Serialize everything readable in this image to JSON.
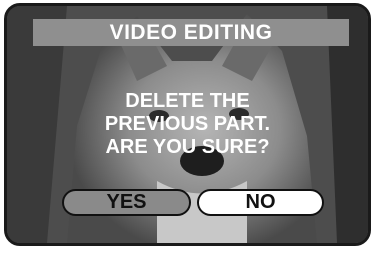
{
  "dialog": {
    "title": "VIDEO EDITING",
    "message_lines": [
      "DELETE THE",
      "PREVIOUS PART.",
      "ARE YOU SURE?"
    ],
    "buttons": {
      "yes": "YES",
      "no": "NO"
    },
    "selected_button": "yes"
  },
  "colors": {
    "title_bar": "#8f8f8f",
    "selected_button": "#8a8a8a",
    "unselected_button": "#ffffff",
    "text": "#ffffff"
  }
}
